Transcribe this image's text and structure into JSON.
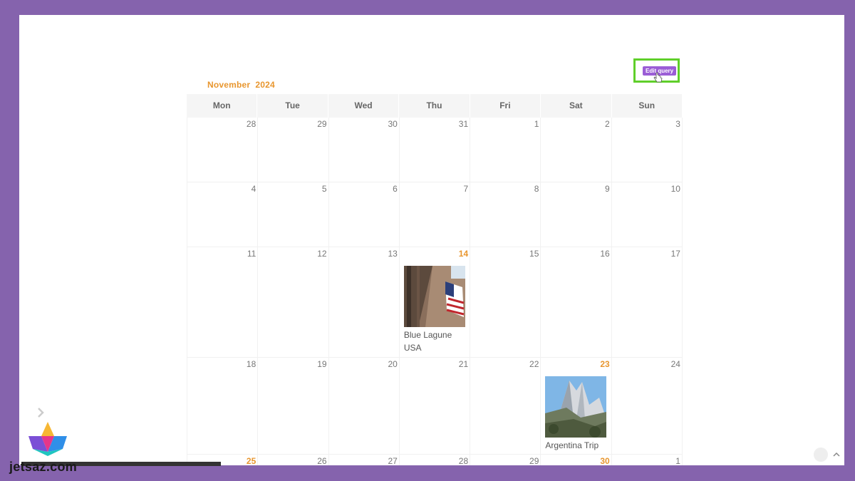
{
  "calendar": {
    "month": "November",
    "year": "2024",
    "edit_query_label": "Edit query",
    "weekdays": [
      "Mon",
      "Tue",
      "Wed",
      "Thu",
      "Fri",
      "Sat",
      "Sun"
    ],
    "weeks": [
      [
        {
          "d": "28"
        },
        {
          "d": "29"
        },
        {
          "d": "30"
        },
        {
          "d": "31"
        },
        {
          "d": "1"
        },
        {
          "d": "2"
        },
        {
          "d": "3"
        }
      ],
      [
        {
          "d": "4"
        },
        {
          "d": "5"
        },
        {
          "d": "6"
        },
        {
          "d": "7"
        },
        {
          "d": "8"
        },
        {
          "d": "9"
        },
        {
          "d": "10"
        }
      ],
      [
        {
          "d": "11"
        },
        {
          "d": "12"
        },
        {
          "d": "13"
        },
        {
          "d": "14",
          "accent": true,
          "event": {
            "title": "Blue Lagune USA",
            "thumb": "flag-photo"
          }
        },
        {
          "d": "15"
        },
        {
          "d": "16"
        },
        {
          "d": "17"
        }
      ],
      [
        {
          "d": "18"
        },
        {
          "d": "19"
        },
        {
          "d": "20"
        },
        {
          "d": "21"
        },
        {
          "d": "22"
        },
        {
          "d": "23",
          "accent": true,
          "event": {
            "title": "Argentina Trip",
            "thumb": "mountain-photo"
          }
        },
        {
          "d": "24"
        }
      ],
      [
        {
          "d": "25",
          "accent": true
        },
        {
          "d": "26"
        },
        {
          "d": "27"
        },
        {
          "d": "28"
        },
        {
          "d": "29"
        },
        {
          "d": "30",
          "accent": true
        },
        {
          "d": "1"
        }
      ]
    ]
  },
  "watermark": {
    "text": "jetsaz.com"
  },
  "colors": {
    "accent": "#e8962e",
    "button": "#9b5dd6",
    "highlight": "#5fcf2a",
    "background": "#8563ad"
  }
}
